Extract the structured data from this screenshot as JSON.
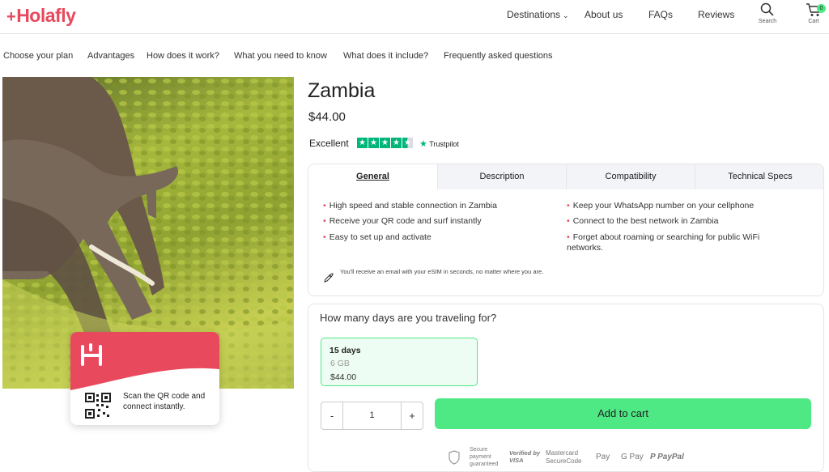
{
  "brand": {
    "name": "Holafly",
    "accent": "#e8495c",
    "green": "#4ee884"
  },
  "header": {
    "nav": [
      "Destinations",
      "About us",
      "FAQs",
      "Reviews"
    ],
    "search_label": "Search",
    "cart_label": "Cart",
    "cart_count": "0"
  },
  "subnav": [
    "Choose your plan",
    "Advantages",
    "How does it work?",
    "What you need to know",
    "What does it include?",
    "Frequently asked questions"
  ],
  "promo": {
    "text": "Scan the QR code and connect instantly."
  },
  "product": {
    "title": "Zambia",
    "price": "$44.00",
    "rating_label": "Excellent",
    "rating_stars": 4.5,
    "trustpilot": "Trustpilot"
  },
  "tabs": [
    "General",
    "Description",
    "Compatibility",
    "Technical Specs"
  ],
  "features": {
    "left": [
      "High speed and stable connection in Zambia",
      "Receive your QR code and surf instantly",
      "Easy to set up and activate"
    ],
    "right": [
      "Keep your WhatsApp number on your cellphone",
      "Connect to the best network in Zambia",
      "Forget about roaming or searching for public WiFi networks."
    ]
  },
  "email_note": "You'll receive an email with your eSIM in seconds, no matter where you are.",
  "plan": {
    "question": "How many days are you traveling for?",
    "days": "15 days",
    "data": "6 GB",
    "price": "$44.00"
  },
  "quantity": {
    "minus": "-",
    "value": "1",
    "plus": "+"
  },
  "add_to_cart": "Add to cart",
  "payments": {
    "secure": "Secure payment guaranteed",
    "visa": "Verified by VISA",
    "mastercard": "Mastercard SecureCode",
    "applepay": "Pay",
    "gpay": "G Pay",
    "paypal": "PayPal"
  }
}
